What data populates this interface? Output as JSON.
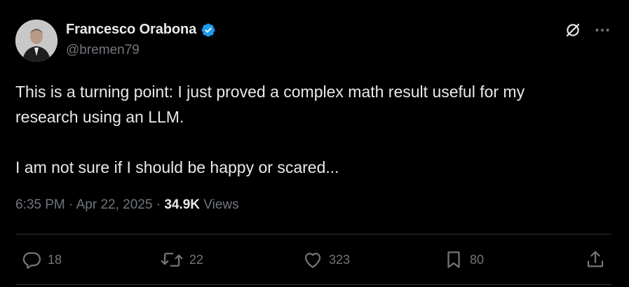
{
  "author": {
    "name": "Francesco Orabona",
    "handle": "@bremen79",
    "verified": true
  },
  "tweet": {
    "lines": [
      "This is a turning point: I just proved a complex math result useful for my",
      "research using an LLM.",
      "I am not sure if I should be happy or scared..."
    ],
    "time": "6:35 PM",
    "separator": "·",
    "date": "Apr 22, 2025",
    "views_count": "34.9K",
    "views_label": "Views"
  },
  "actions": {
    "reply": "18",
    "retweet": "22",
    "like": "323",
    "bookmark": "80"
  },
  "icons": {
    "verified": "verified-badge-icon",
    "grok": "grok-icon",
    "more": "more-options-icon",
    "reply": "reply-icon",
    "retweet": "retweet-icon",
    "like": "heart-icon",
    "bookmark": "bookmark-icon",
    "share": "share-icon"
  },
  "colors": {
    "background": "#000000",
    "text_primary": "#e7e9ea",
    "text_secondary": "#71767b",
    "verified_blue": "#1d9bf0",
    "divider": "#2f3336"
  }
}
